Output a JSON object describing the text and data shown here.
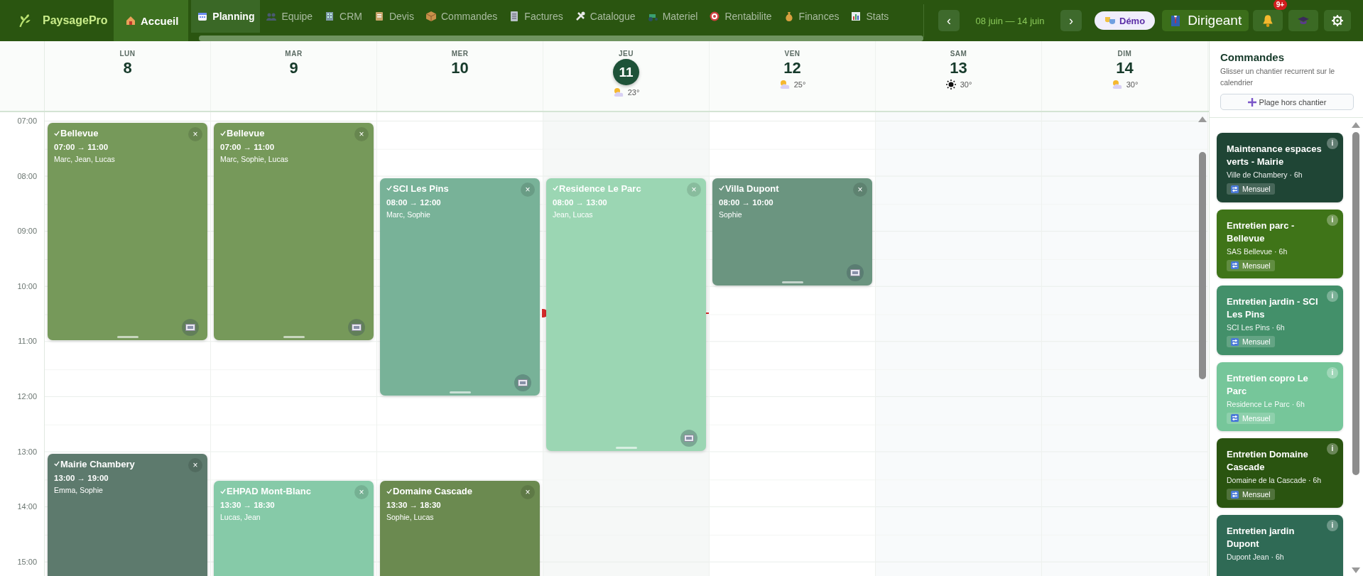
{
  "app": {
    "name": "PaysagePro"
  },
  "nav": {
    "items": [
      {
        "label": "Accueil",
        "kind": "home",
        "selected": false
      },
      {
        "label": "Planning",
        "kind": "page",
        "selected": true
      },
      {
        "label": "Equipe",
        "kind": "page",
        "selected": false
      },
      {
        "label": "CRM",
        "kind": "page",
        "selected": false
      },
      {
        "label": "Devis",
        "kind": "page",
        "selected": false
      },
      {
        "label": "Commandes",
        "kind": "page",
        "selected": false
      },
      {
        "label": "Factures",
        "kind": "page",
        "selected": false
      },
      {
        "label": "Catalogue",
        "kind": "page",
        "selected": false
      },
      {
        "label": "Materiel",
        "kind": "page",
        "selected": false
      },
      {
        "label": "Rentabilite",
        "kind": "page",
        "selected": false
      },
      {
        "label": "Finances",
        "kind": "page",
        "selected": false
      },
      {
        "label": "Stats",
        "kind": "page",
        "selected": false
      }
    ]
  },
  "week": {
    "prev": "‹",
    "range": "08 juin — 14 juin",
    "next": "›"
  },
  "demo": {
    "label": "Démo"
  },
  "role": {
    "label": "Dirigeant"
  },
  "notifications": {
    "badge": "9+"
  },
  "calendar": {
    "hours": [
      "07:00",
      "08:00",
      "09:00",
      "10:00",
      "11:00",
      "12:00",
      "13:00",
      "14:00",
      "15:00"
    ],
    "days": [
      {
        "weekday": "LUN",
        "date": "8",
        "today": false,
        "weekend": false,
        "events": [
          {
            "title": "Bellevue",
            "time": "07:00 → 11:00",
            "crew": "Marc, Jean, Lucas",
            "close": "×",
            "color": "#76995a"
          },
          {
            "title": "Mairie Chambery",
            "time": "13:00 → 19:00",
            "crew": "Emma, Sophie",
            "close": "×",
            "color": "#5d7a6d"
          }
        ]
      },
      {
        "weekday": "MAR",
        "date": "9",
        "today": false,
        "weekend": false,
        "events": [
          {
            "title": "Bellevue",
            "time": "07:00 → 11:00",
            "crew": "Marc, Sophie, Lucas",
            "close": "×",
            "color": "#76995a"
          },
          {
            "title": "EHPAD Mont-Blanc",
            "time": "13:30 → 18:30",
            "crew": "Lucas, Jean",
            "close": "×",
            "color": "#86caa8"
          }
        ]
      },
      {
        "weekday": "MER",
        "date": "10",
        "today": false,
        "weekend": false,
        "events": [
          {
            "title": "SCI Les Pins",
            "time": "08:00 → 12:00",
            "crew": "Marc, Sophie",
            "close": "×",
            "color": "#78b298"
          },
          {
            "title": "Domaine Cascade",
            "time": "13:30 → 18:30",
            "crew": "Sophie, Lucas",
            "close": "×",
            "color": "#6b8a50"
          }
        ]
      },
      {
        "weekday": "JEU",
        "date": "11",
        "today": true,
        "weekend": false,
        "weather": {
          "kind": "partly_cloudy",
          "temp": "23°"
        },
        "events": [
          {
            "title": "Residence Le Parc",
            "time": "08:00 → 13:00",
            "crew": "Jean, Lucas",
            "close": "×",
            "color": "#9bd6b3"
          }
        ]
      },
      {
        "weekday": "VEN",
        "date": "12",
        "today": false,
        "weekend": false,
        "weather": {
          "kind": "partly_cloudy",
          "temp": "25°"
        },
        "events": [
          {
            "title": "Villa Dupont",
            "time": "08:00 → 10:00",
            "crew": "Sophie",
            "close": "×",
            "color": "#6b9580"
          }
        ]
      },
      {
        "weekday": "SAM",
        "date": "13",
        "today": false,
        "weekend": true,
        "weather": {
          "kind": "sunny",
          "temp": "30°"
        }
      },
      {
        "weekday": "DIM",
        "date": "14",
        "today": false,
        "weekend": true,
        "weather": {
          "kind": "partly_cloudy",
          "temp": "30°"
        }
      }
    ]
  },
  "sidebar": {
    "title": "Commandes",
    "hint": "Glisser un chantier recurrent sur le calendrier",
    "add_button": "Plage hors chantier",
    "cards": [
      {
        "title": "Maintenance espaces verts - Mairie",
        "subtitle": "Ville de Chambery · 6h",
        "badge": "Mensuel",
        "info": "i",
        "color": "#1f4535"
      },
      {
        "title": "Entretien parc - Bellevue",
        "subtitle": "SAS Bellevue · 6h",
        "badge": "Mensuel",
        "info": "i",
        "color": "#3f7418"
      },
      {
        "title": "Entretien jardin - SCI Les Pins",
        "subtitle": "SCI Les Pins · 6h",
        "badge": "Mensuel",
        "info": "i",
        "color": "#43906a"
      },
      {
        "title": "Entretien copro Le Parc",
        "subtitle": "Residence Le Parc · 6h",
        "badge": "Mensuel",
        "info": "i",
        "color": "#76c69a"
      },
      {
        "title": "Entretien Domaine Cascade",
        "subtitle": "Domaine de la Cascade · 6h",
        "badge": "Mensuel",
        "info": "i",
        "color": "#2a5410"
      },
      {
        "title": "Entretien jardin Dupont",
        "subtitle": "Dupont Jean · 6h",
        "info": "i",
        "color": "#2f6a55"
      }
    ]
  }
}
